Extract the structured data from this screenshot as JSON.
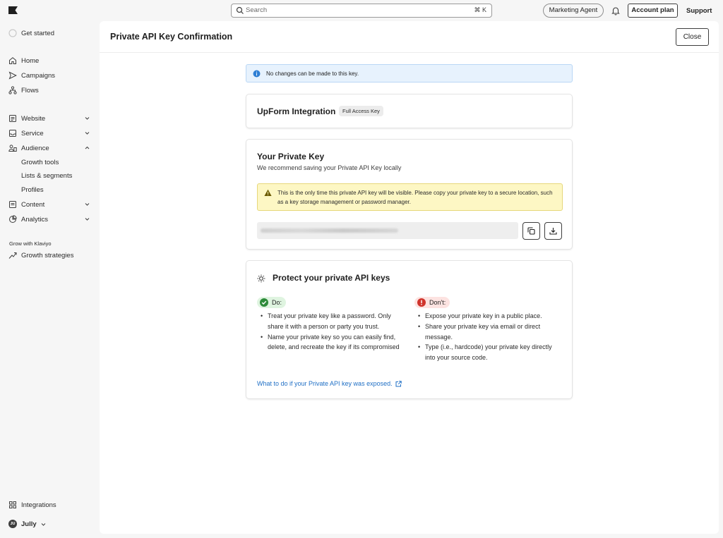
{
  "topbar": {
    "search_placeholder": "Search",
    "search_shortcut": "⌘ K",
    "agent_button": "Marketing Agent",
    "account_button": "Account plan",
    "support_link": "Support"
  },
  "sidebar": {
    "get_started": "Get started",
    "items": [
      {
        "label": "Home",
        "icon": "home-icon"
      },
      {
        "label": "Campaigns",
        "icon": "send-icon"
      },
      {
        "label": "Flows",
        "icon": "flows-icon"
      },
      {
        "label": "Website",
        "icon": "website-icon"
      },
      {
        "label": "Service",
        "icon": "inbox-icon"
      },
      {
        "label": "Audience",
        "icon": "audience-icon"
      },
      {
        "label": "Content",
        "icon": "content-icon"
      },
      {
        "label": "Analytics",
        "icon": "analytics-icon"
      }
    ],
    "audience_sub": [
      "Growth tools",
      "Lists & segments",
      "Profiles"
    ],
    "grow_heading": "Grow with Klaviyo",
    "growth_strategies": "Growth strategies",
    "integrations": "Integrations",
    "user_initials": "JU",
    "user_name": "Jully"
  },
  "panel": {
    "title": "Private API Key Confirmation",
    "close_label": "Close",
    "alert": "No changes can be made to this key.",
    "key_name": "UpForm Integration",
    "key_scope": "Full Access Key",
    "private_key_heading": "Your Private Key",
    "private_key_sub": "We recommend saving your Private API Key locally",
    "warning": "This is the only time this private API key will be visible. Please copy your private key to a secure location, such as a key storage management or password manager.",
    "protect_heading": "Protect your private API keys",
    "do_label": "Do:",
    "dont_label": "Don't:",
    "do_items": [
      "Treat your private key like a password. Only share it with a person or party you trust.",
      "Name your private key so you can easily find, delete, and recreate the key if its compromised"
    ],
    "dont_items": [
      "Expose your private key in a public place.",
      "Share your private key via email or direct message.",
      "Type (i.e., hardcode) your private key directly into your source code."
    ],
    "exposed_link": "What to do if your Private API key was exposed."
  },
  "colors": {
    "info_bg": "#e7f2fd",
    "warning_bg": "#fdf7c4",
    "do_green": "#2e8b3a",
    "dont_red": "#d0342c",
    "link_blue": "#1f6fc5"
  }
}
